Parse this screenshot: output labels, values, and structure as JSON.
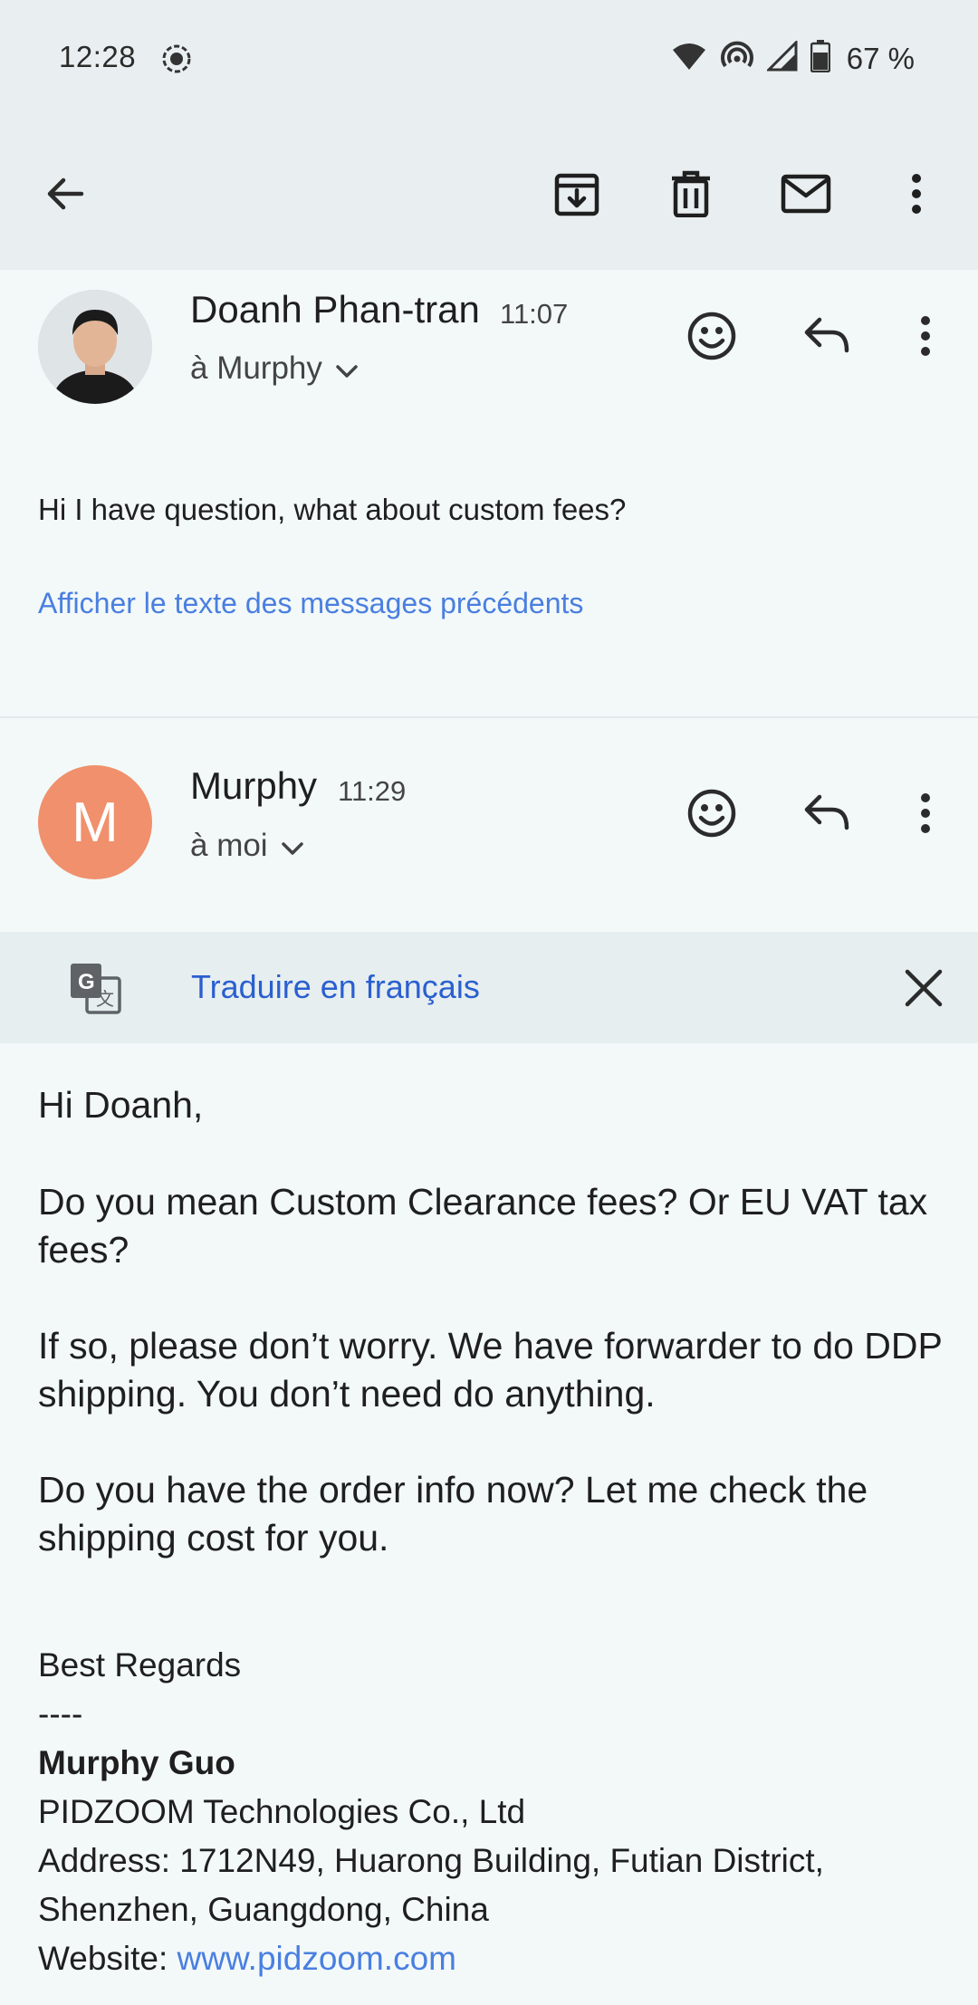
{
  "status_bar": {
    "time": "12:28",
    "battery": "67 %",
    "icons": [
      "record-icon",
      "wifi-icon",
      "hotspot-icon",
      "signal-icon",
      "battery-icon"
    ]
  },
  "toolbar": {
    "icons": [
      "back-arrow-icon",
      "archive-icon",
      "delete-icon",
      "mark-unread-icon",
      "more-vert-icon"
    ]
  },
  "message1": {
    "sender": "Doanh Phan-tran",
    "time": "11:07",
    "recipient": "à Murphy",
    "body": "Hi I have question, what about custom fees?",
    "show_quoted": "Afficher le texte des messages précédents"
  },
  "message2": {
    "avatar_letter": "M",
    "sender": "Murphy",
    "time": "11:29",
    "recipient": "à moi",
    "translate": "Traduire en français",
    "body": {
      "greeting": "Hi Doanh,",
      "p1": "Do you mean Custom Clearance fees? Or EU VAT tax fees?",
      "p2": "If so, please don’t worry. We have forwarder to do DDP shipping. You don’t need do anything.",
      "p3": "Do you have the order info now? Let me check the shipping cost for you."
    },
    "signature": {
      "closing": "Best Regards",
      "dashes": "----",
      "name": "Murphy Guo",
      "company": "PIDZOOM Technologies Co., Ltd",
      "address_line1": "Address: 1712N49, Huarong Building, Futian District,",
      "address_line2": "Shenzhen, Guangdong, China",
      "website_label": "Website: ",
      "website_url": "www.pidzoom.com"
    }
  },
  "colors": {
    "toolbar_bg": "#e9eff0",
    "page_bg": "#f3f9f9",
    "avatar_m": "#f0906c",
    "link": "#4a7fe0",
    "translate_link": "#2a5fd0"
  }
}
